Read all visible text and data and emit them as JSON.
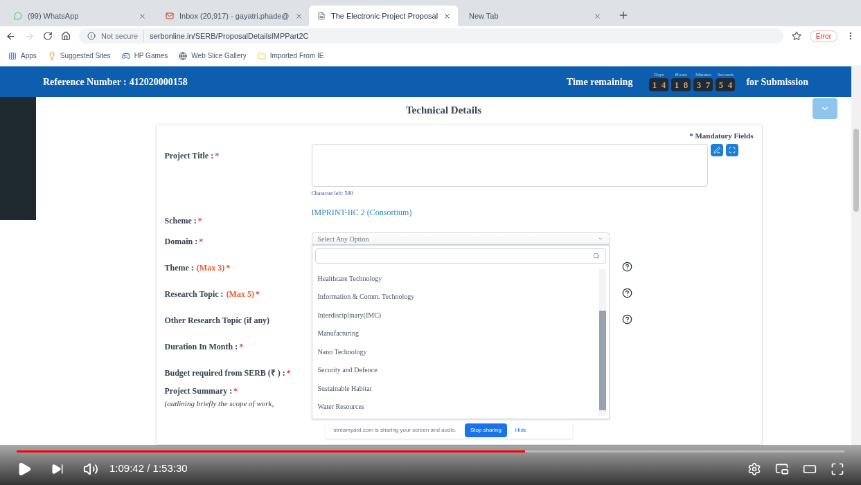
{
  "browser": {
    "tabs": [
      {
        "kind": "whatsapp",
        "title": "(99) WhatsApp",
        "selected": false
      },
      {
        "kind": "mail",
        "title": "Inbox (20,917) - gayatri.phade@",
        "selected": false
      },
      {
        "kind": "page",
        "title": "The Electronic Project Proposal",
        "selected": true
      },
      {
        "kind": "blank",
        "title": "New Tab",
        "selected": false
      }
    ],
    "security": "Not secure",
    "url": "serbonline.in/SERB/ProposalDetailsIMPPart2C",
    "profile": "Error",
    "bookmarks": [
      {
        "kind": "apps",
        "label": "Apps"
      },
      {
        "kind": "suggested",
        "label": "Suggested Sites"
      },
      {
        "kind": "games",
        "label": "HP Games"
      },
      {
        "kind": "globe",
        "label": "Web Slice Gallery"
      },
      {
        "kind": "folder",
        "label": "Imported From IE"
      }
    ]
  },
  "header": {
    "reference_label": "Reference Number :",
    "reference_value": "412020000158",
    "time_label": "Time remaining",
    "suffix": "for Submission",
    "countdown": [
      {
        "unit": "Days",
        "digits": [
          "1",
          "4"
        ]
      },
      {
        "unit": "Hours",
        "digits": [
          "1",
          "8"
        ]
      },
      {
        "unit": "Minutes",
        "digits": [
          "3",
          "7"
        ]
      },
      {
        "unit": "Seconds",
        "digits": [
          "5",
          "4"
        ]
      }
    ]
  },
  "required_mark": "*",
  "section_title": "Technical Details",
  "mandatory_note": "* Mandatory Fields",
  "project_title": {
    "label": "Project Title :",
    "required": true,
    "chars_left": "Character left: 500"
  },
  "scheme": {
    "label": "Scheme :",
    "required": true,
    "value": "IMPRINT-IIC 2 (Consortium)"
  },
  "domain": {
    "label": "Domain :",
    "required": true,
    "placeholder": "Select Any Option",
    "options": [
      "Healthcare Technology",
      "Information & Comm. Technology",
      "Interdisciplinary(IMC)",
      "Manufacturing",
      "Nano Technology",
      "Security and Defence",
      "Sustainable Habitat",
      "Water Resources"
    ]
  },
  "fields": [
    {
      "label": "Theme :",
      "note": "(Max 3)",
      "required": true,
      "help": true
    },
    {
      "label": "Research Topic :",
      "note": "(Max 5)",
      "required": true,
      "help": true
    },
    {
      "label": "Other Research Topic (if any)",
      "required": false,
      "help": true
    },
    {
      "label": "Duration In Month :",
      "required": true,
      "help": false
    },
    {
      "label": "Budget required from SERB (₹ ) :",
      "required": true,
      "help": false
    }
  ],
  "summary": {
    "label": "Project Summary :",
    "required": true,
    "hint": "(outlining briefly the scope of work,"
  },
  "share_bar": {
    "message": "streamyard.com is sharing your screen and audio.",
    "stop": "Stop sharing",
    "hide": "Hide"
  },
  "player": {
    "time": "1:09:42 / 1:53:30",
    "level": 0.614
  }
}
